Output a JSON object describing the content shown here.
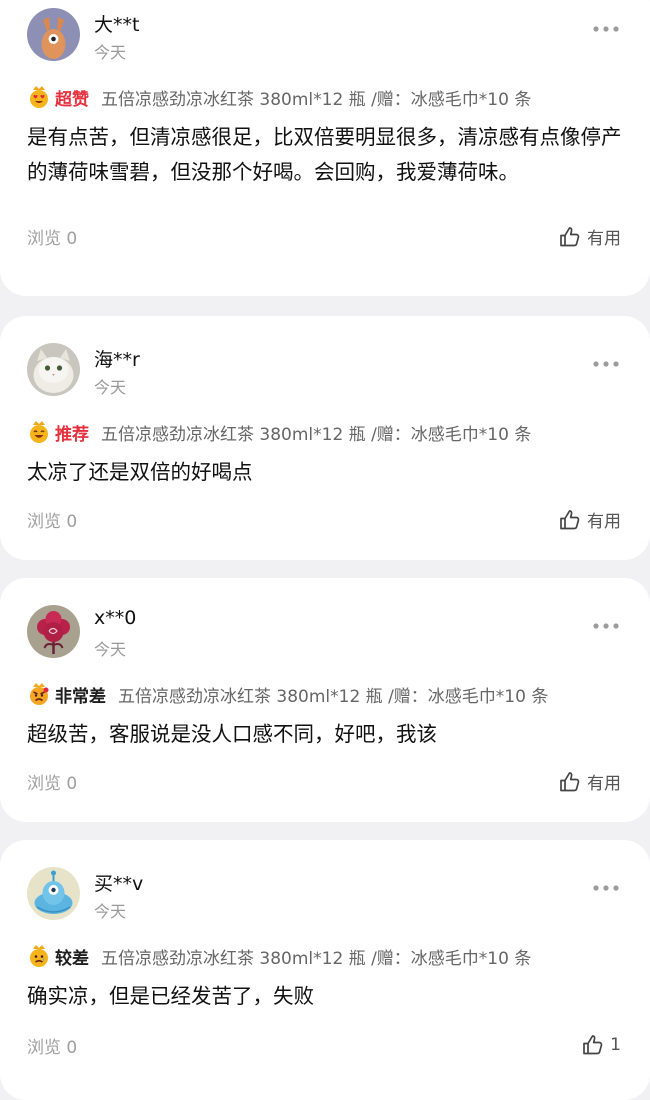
{
  "reviews": [
    {
      "user": "大**t",
      "date": "今天",
      "rating_label": "超赞",
      "rating_color": "#e5313d",
      "product": "五倍凉感劲凉冰红茶 380ml*12 瓶 /赠：冰感毛巾*10 条",
      "content": "是有点苦，但清凉感很足，比双倍要明显很多，清凉感有点像停产的薄荷味雪碧，但没那个好喝。会回购，我爱薄荷味。",
      "views": "浏览 0",
      "helpful": "有用",
      "avatar": "deer-avatar-icon"
    },
    {
      "user": "海**r",
      "date": "今天",
      "rating_label": "推荐",
      "rating_color": "#e5313d",
      "product": "五倍凉感劲凉冰红茶 380ml*12 瓶 /赠：冰感毛巾*10 条",
      "content": "太凉了还是双倍的好喝点",
      "views": "浏览 0",
      "helpful": "有用",
      "avatar": "cat-avatar-icon"
    },
    {
      "user": "x**0",
      "date": "今天",
      "rating_label": "非常差",
      "rating_color": "#1f1f1f",
      "product": "五倍凉感劲凉冰红茶 380ml*12 瓶 /赠：冰感毛巾*10 条",
      "content": "超级苦，客服说是没人口感不同，好吧，我该",
      "views": "浏览 0",
      "helpful": "有用",
      "avatar": "flower-avatar-icon"
    },
    {
      "user": "买**v",
      "date": "今天",
      "rating_label": "较差",
      "rating_color": "#1f1f1f",
      "product": "五倍凉感劲凉冰红茶 380ml*12 瓶 /赠：冰感毛巾*10 条",
      "content": "确实凉，但是已经发苦了，失败",
      "views": "浏览 0",
      "helpful": "1",
      "avatar": "alien-avatar-icon"
    }
  ]
}
